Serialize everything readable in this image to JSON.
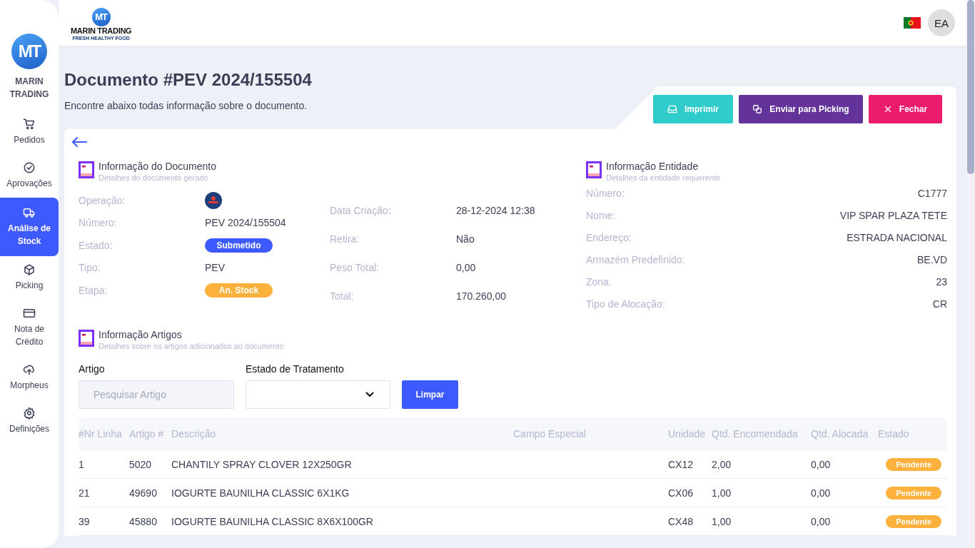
{
  "sidebar": {
    "logo_mark": "MT",
    "brand": "MARIN TRADING",
    "items": [
      {
        "label": "Pedidos",
        "selected": false
      },
      {
        "label": "Aprovações",
        "selected": false
      },
      {
        "label": "Análise de Stock",
        "selected": true
      },
      {
        "label": "Picking",
        "selected": false
      },
      {
        "label": "Nota de Crédito",
        "selected": false
      },
      {
        "label": "Morpheus",
        "selected": false
      },
      {
        "label": "Definições",
        "selected": false
      }
    ]
  },
  "header": {
    "logo_mark": "MT",
    "logo_name": "MARIN TRADING",
    "logo_tagline": "FRESH HEALTHY FOOD",
    "avatar": "EA"
  },
  "page": {
    "title": "Documento #PEV 2024/155504",
    "subtitle": "Encontre abaixo todas informação sobre o documento.",
    "actions": [
      {
        "label": "Imprimir",
        "kind": "print"
      },
      {
        "label": "Enviar para Picking",
        "kind": "send"
      },
      {
        "label": "Fechar",
        "kind": "close"
      }
    ]
  },
  "document_info": {
    "title": "Informação do Documento",
    "subtitle": "Detalhes do documento gerado",
    "fields_left": [
      {
        "label": "Operação:",
        "kind": "logo"
      },
      {
        "label": "Número:",
        "kind": "text",
        "value": "PEV 2024/155504"
      },
      {
        "label": "Estado:",
        "kind": "badge",
        "value": "Submetido",
        "color": "#3d5afe"
      },
      {
        "label": "Tipo:",
        "kind": "text",
        "value": "PEV"
      },
      {
        "label": "Etapa:",
        "kind": "badge",
        "value": "An. Stock",
        "color": "#fbb13c"
      }
    ],
    "fields_right": [
      {
        "label": "Data Criação:",
        "value": "28-12-2024 12:38"
      },
      {
        "label": "Retira:",
        "value": "Não"
      },
      {
        "label": "Peso Total:",
        "value": "0,00"
      },
      {
        "label": "Total:",
        "value": "170.260,00"
      }
    ]
  },
  "entity_info": {
    "title": "Informação Entidade",
    "subtitle": "Detalhes da entidade requerente",
    "fields": [
      {
        "label": "Número:",
        "value": "C1777"
      },
      {
        "label": "Nome:",
        "value": "VIP SPAR PLAZA TETE"
      },
      {
        "label": "Endereço:",
        "value": "ESTRADA NACIONAL"
      },
      {
        "label": "Armazém Predefinido:",
        "value": "BE.VD"
      },
      {
        "label": "Zona:",
        "value": "23"
      },
      {
        "label": "Tipo de Alocação:",
        "value": "CR"
      }
    ]
  },
  "articles": {
    "title": "Informação Artigos",
    "subtitle": "Detalhes sobre os artigos adicionados ao documento",
    "filters": {
      "search": {
        "label": "Artigo",
        "placeholder": "Pesquisar Artigo"
      },
      "status": {
        "label": "Estado de Tratamento"
      },
      "clear_button": "Limpar"
    },
    "table": {
      "columns": [
        "#Nr Linha",
        "Artigo #",
        "Descrição",
        "Campo Especial",
        "Unidade",
        "Qtd. Encomendada",
        "Qtd. Alocada",
        "Estado"
      ],
      "rows": [
        {
          "line": "1",
          "article": "5020",
          "description": "CHANTILY SPRAY CLOVER 12X250GR",
          "unit": "CX12",
          "ordered": "2,00",
          "allocated": "0,00",
          "status": {
            "label": "Pendente",
            "color": "#fbb13c"
          }
        },
        {
          "line": "21",
          "article": "49690",
          "description": "IOGURTE BAUNILHA CLASSIC 6X1KG",
          "unit": "CX06",
          "ordered": "1,00",
          "allocated": "0,00",
          "status": {
            "label": "Pendente",
            "color": "#fbb13c"
          }
        },
        {
          "line": "39",
          "article": "45880",
          "description": "IOGURTE BAUNILHA CLASSIC 8X6X100GR",
          "unit": "CX48",
          "ordered": "1,00",
          "allocated": "0,00",
          "status": {
            "label": "Pendente",
            "color": "#fbb13c"
          }
        }
      ]
    }
  }
}
